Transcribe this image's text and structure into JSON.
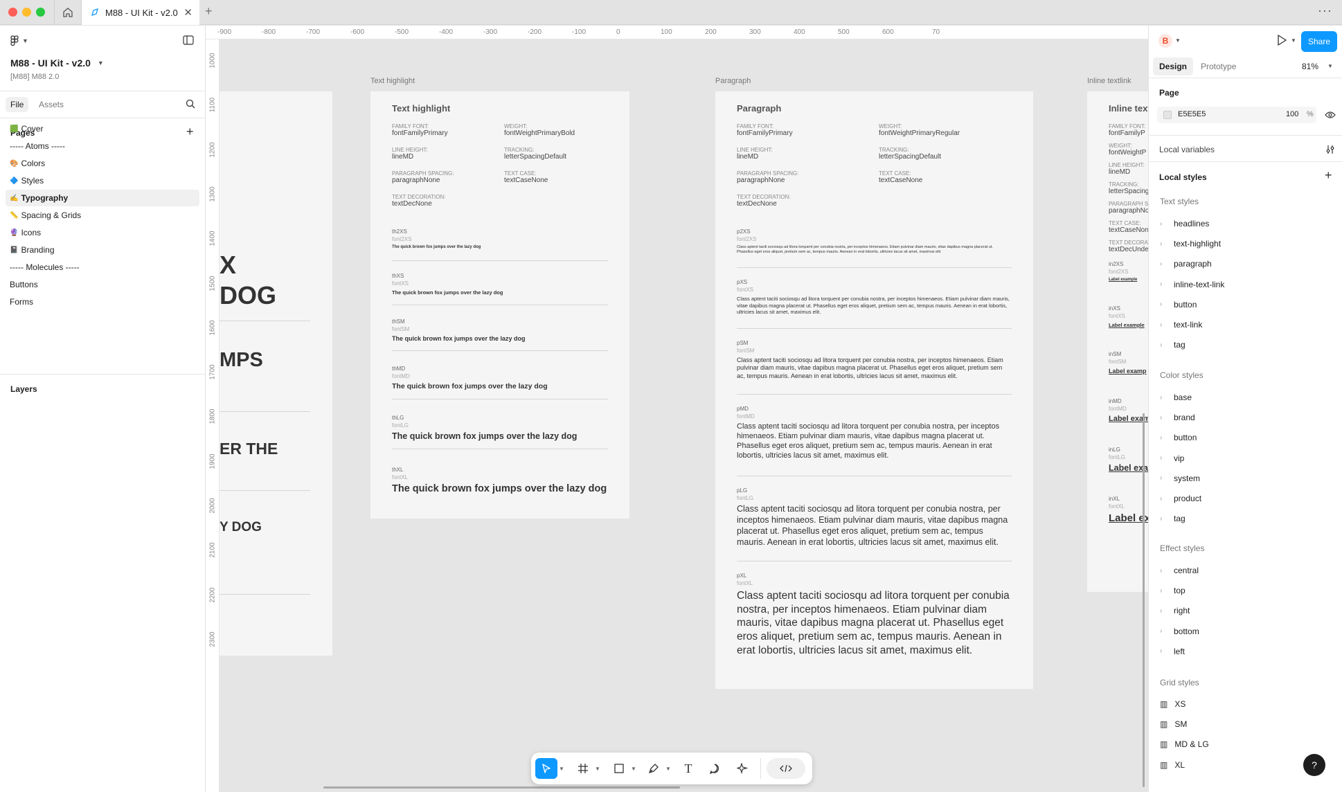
{
  "titlebar": {
    "tab_title": "M88 - UI Kit - v2.0",
    "close": "✕",
    "new_tab": "+",
    "more": "···"
  },
  "left": {
    "file_name": "M88 - UI Kit - v2.0",
    "file_sub": "[M88] M88 2.0",
    "tabs": [
      "File",
      "Assets"
    ],
    "pages_title": "Pages",
    "add": "+",
    "pages": [
      {
        "icon": "🟩",
        "label": "Cover"
      },
      {
        "icon": "",
        "label": "----- Atoms -----"
      },
      {
        "icon": "🎨",
        "label": "Colors"
      },
      {
        "icon": "🔷",
        "label": "Styles"
      },
      {
        "icon": "✍️",
        "label": "Typography"
      },
      {
        "icon": "📏",
        "label": "Spacing & Grids"
      },
      {
        "icon": "🔮",
        "label": "Icons"
      },
      {
        "icon": "📓",
        "label": "Branding"
      },
      {
        "icon": "",
        "label": "----- Molecules -----"
      },
      {
        "icon": "",
        "label": "Buttons"
      },
      {
        "icon": "",
        "label": "Forms"
      }
    ],
    "layers_title": "Layers"
  },
  "right": {
    "tabs": [
      "Design",
      "Prototype"
    ],
    "zoom": "81%",
    "share": "Share",
    "page_title": "Page",
    "page_color": "E5E5E5",
    "page_opacity": "100",
    "percent": "%",
    "local_variables": "Local variables",
    "local_styles": "Local styles",
    "add": "+",
    "text_styles_title": "Text styles",
    "text_styles": [
      "headlines",
      "text-highlight",
      "paragraph",
      "inline-text-link",
      "button",
      "text-link",
      "tag"
    ],
    "color_styles_title": "Color styles",
    "color_styles": [
      "base",
      "brand",
      "button",
      "vip",
      "system",
      "product",
      "tag"
    ],
    "effect_styles_title": "Effect styles",
    "effect_styles": [
      "central",
      "top",
      "right",
      "bottom",
      "left"
    ],
    "grid_styles_title": "Grid styles",
    "grid_styles": [
      "XS",
      "SM",
      "MD & LG",
      "XL"
    ],
    "help": "?"
  },
  "ruler": {
    "h": [
      "-900",
      "-800",
      "-700",
      "-600",
      "-500",
      "-400",
      "-300",
      "-200",
      "-100",
      "0",
      "100",
      "200",
      "300",
      "400",
      "500",
      "600",
      "70"
    ],
    "v": [
      "1000",
      "1100",
      "1200",
      "1300",
      "1400",
      "1500",
      "1600",
      "1700",
      "1800",
      "1900",
      "2000",
      "2100",
      "2200",
      "2300"
    ]
  },
  "canvas": {
    "left_frame": {
      "big1": "X",
      "big2": "DOG",
      "big3": "MPS",
      "big4": "ER THE",
      "big5": "Y DOG"
    },
    "th": {
      "label": "Text highlight",
      "title": "Text highlight",
      "specs": [
        [
          "Family font:",
          "fontFamilyPrimary"
        ],
        [
          "Weight:",
          "fontWeightPrimaryBold"
        ],
        [
          "Line height:",
          "lineMD"
        ],
        [
          "Tracking:",
          "letterSpacingDefault"
        ],
        [
          "Paragraph spacing:",
          "paragraphNone"
        ],
        [
          "Text case:",
          "textCaseNone"
        ],
        [
          "Text decoration:",
          "textDecNone"
        ]
      ],
      "rows": [
        {
          "t": "th2XS",
          "f": "font2XS"
        },
        {
          "t": "thXS",
          "f": "fontXS"
        },
        {
          "t": "thSM",
          "f": "fontSM"
        },
        {
          "t": "thMD",
          "f": "fontMD"
        },
        {
          "t": "thLG",
          "f": "fontLG"
        },
        {
          "t": "thXL",
          "f": "fontXL"
        }
      ],
      "sample": "The quick brown fox jumps over the lazy dog"
    },
    "p": {
      "label": "Paragraph",
      "title": "Paragraph",
      "specs": [
        [
          "Family font:",
          "fontFamilyPrimary"
        ],
        [
          "Weight:",
          "fontWeightPrimaryRegular"
        ],
        [
          "Line height:",
          "lineMD"
        ],
        [
          "Tracking:",
          "letterSpacingDefault"
        ],
        [
          "Paragraph spacing:",
          "paragraphNone"
        ],
        [
          "Text case:",
          "textCaseNone"
        ],
        [
          "Text decoration:",
          "textDecNone"
        ]
      ],
      "rows": [
        {
          "t": "p2XS",
          "f": "font2XS"
        },
        {
          "t": "pXS",
          "f": "fontXS"
        },
        {
          "t": "pSM",
          "f": "fontSM"
        },
        {
          "t": "pMD",
          "f": "fontMD"
        },
        {
          "t": "pLG",
          "f": "fontLG"
        },
        {
          "t": "pXL",
          "f": "fontXL"
        }
      ],
      "sample": "Class aptent taciti sociosqu ad litora torquent per conubia nostra, per inceptos himenaeos. Etiam pulvinar diam mauris, vitae dapibus magna placerat ut. Phasellus eget eros aliquet, pretium sem ac, tempus mauris. Aenean in erat lobortis, ultricies lacus sit amet, maximus elit."
    },
    "il": {
      "label": "Inline textlink",
      "title": "Inline text",
      "specs": [
        [
          "Family font:",
          "fontFamilyP"
        ],
        [
          "Weight:",
          "fontWeightP"
        ],
        [
          "Line height:",
          "lineMD"
        ],
        [
          "Tracking:",
          "letterSpacing"
        ],
        [
          "Paragraph spacing:",
          "paragraphNo"
        ],
        [
          "Text case:",
          "textCaseNon"
        ],
        [
          "Text decoration:",
          "textDecUnde"
        ]
      ],
      "rows": [
        {
          "t": "in2XS",
          "f": "font2XS"
        },
        {
          "t": "inXS",
          "f": "fontXS"
        },
        {
          "t": "inSM",
          "f": "fontSM"
        },
        {
          "t": "inMD",
          "f": "fontMD"
        },
        {
          "t": "inLG",
          "f": "fontLG"
        },
        {
          "t": "inXL",
          "f": "fontXL"
        }
      ],
      "sample": "Label example",
      "samples_cut": [
        "Label example",
        "Label example",
        "Label examp",
        "Label exam",
        "Label exa",
        "Label ex"
      ]
    }
  },
  "colors": {
    "accent": "#0d99ff",
    "canvas": "#e5e5e5",
    "frame": "#f5f5f6"
  }
}
